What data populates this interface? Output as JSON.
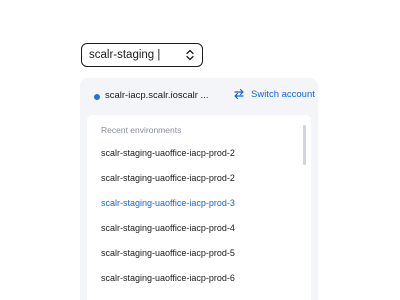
{
  "environment_select": {
    "value": "scalr-staging |",
    "icon": "chevron-up-down-icon"
  },
  "account": {
    "status_color": "#1a73e8",
    "name": "scalr-iacp.scalr.ioscalr ...",
    "switch_label": "Switch account",
    "switch_icon": "swap-arrows-icon",
    "accent_color": "#1565d8"
  },
  "recent": {
    "heading": "Recent environments",
    "items": [
      {
        "label": "scalr-staging-uaoffice-iacp-prod-2"
      },
      {
        "label": "scalr-staging-uaoffice-iacp-prod-2"
      },
      {
        "label": "scalr-staging-uaoffice-iacp-prod-3",
        "selected": true
      },
      {
        "label": "scalr-staging-uaoffice-iacp-prod-4"
      },
      {
        "label": "scalr-staging-uaoffice-iacp-prod-5"
      },
      {
        "label": "scalr-staging-uaoffice-iacp-prod-6"
      }
    ]
  }
}
